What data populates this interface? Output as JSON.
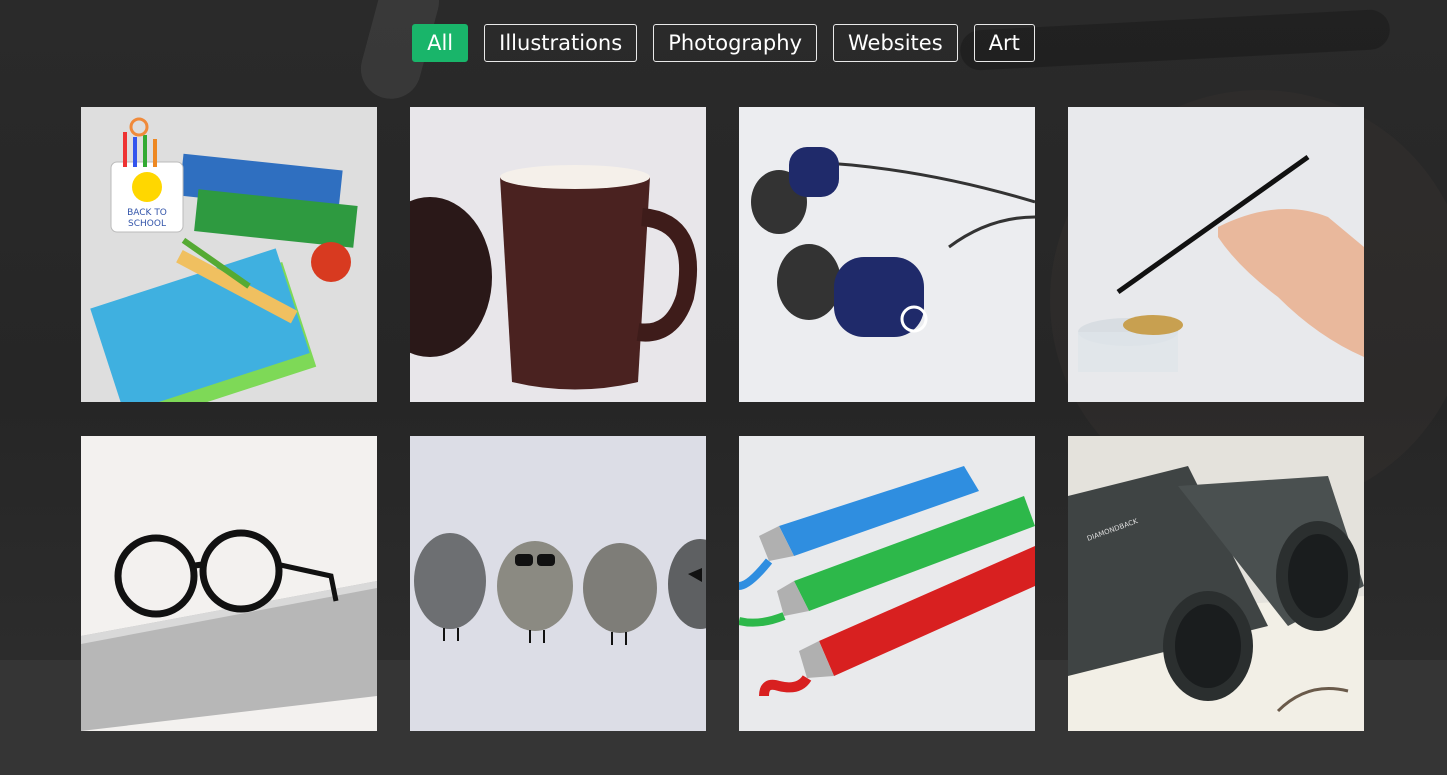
{
  "filters": {
    "items": [
      {
        "label": "All",
        "active": true
      },
      {
        "label": "Illustrations",
        "active": false
      },
      {
        "label": "Photography",
        "active": false
      },
      {
        "label": "Websites",
        "active": false
      },
      {
        "label": "Art",
        "active": false
      }
    ]
  },
  "colors": {
    "accent": "#19b56a",
    "page_bg": "#353535",
    "hero_bg": "#272727"
  },
  "gallery": {
    "items": [
      {
        "subject": "back-to-school-illustration",
        "mug_line1": "BACK TO",
        "mug_line2": "SCHOOL"
      },
      {
        "subject": "coffee-mug-photo"
      },
      {
        "subject": "earphones-photo"
      },
      {
        "subject": "paintbrush-hand-photo"
      },
      {
        "subject": "glasses-on-laptop-photo"
      },
      {
        "subject": "pebble-characters-photo"
      },
      {
        "subject": "paint-tubes-illustration"
      },
      {
        "subject": "binoculars-photo",
        "brand": "DIAMONDBACK"
      }
    ]
  }
}
